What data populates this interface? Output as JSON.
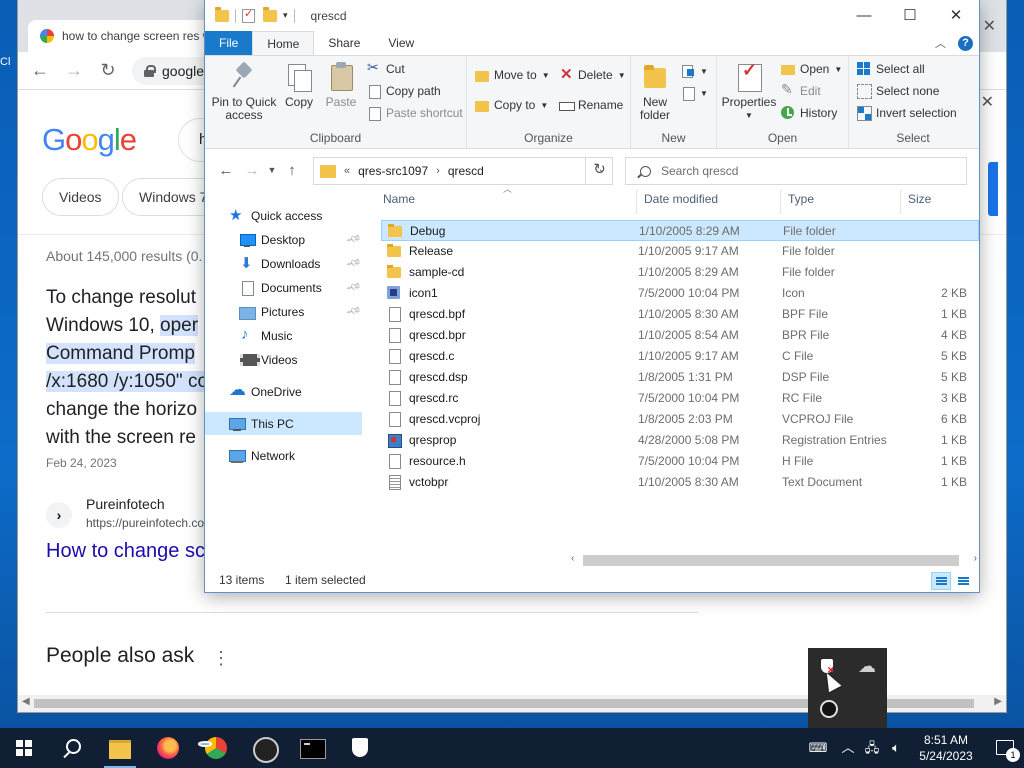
{
  "desktop": {
    "edge_text": "Cl"
  },
  "chrome": {
    "tab_title": "how to change screen res w",
    "url": "google.",
    "search_query_partial": "h",
    "chips": [
      "Videos",
      "Windows 7"
    ],
    "result_stats": "About 145,000 results (0.",
    "snippet_lines": [
      {
        "pre": "To change resolut",
        "hl": ""
      },
      {
        "pre": "Windows 10, ",
        "hl": "oper"
      },
      {
        "pre": "",
        "hl": "Command Promp"
      },
      {
        "pre": "",
        "hl": "/x:1680 /y:1050\" co"
      },
      {
        "pre": "change the horizo",
        "hl": ""
      },
      {
        "pre": "with the screen re",
        "hl": ""
      }
    ],
    "snippet_date": "Feb 24, 2023",
    "source_name": "Pureinfotech",
    "source_url": "https://pureinfotech.co",
    "result_title": "How to change sc",
    "people_also_ask": "People also ask"
  },
  "explorer": {
    "window_title": "qrescd",
    "ribbon_tabs": [
      "File",
      "Home",
      "Share",
      "View"
    ],
    "active_tab": "Home",
    "clipboard": {
      "pin_label": "Pin to Quick access",
      "copy": "Copy",
      "paste": "Paste",
      "cut": "Cut",
      "copy_path": "Copy path",
      "paste_shortcut": "Paste shortcut",
      "group": "Clipboard"
    },
    "organize": {
      "move_to": "Move to",
      "copy_to": "Copy to",
      "delete": "Delete",
      "rename": "Rename",
      "group": "Organize"
    },
    "new": {
      "new_folder": "New folder",
      "group": "New"
    },
    "open": {
      "properties": "Properties",
      "open": "Open",
      "edit": "Edit",
      "history": "History",
      "group": "Open"
    },
    "select": {
      "select_all": "Select all",
      "select_none": "Select none",
      "invert": "Invert selection",
      "group": "Select"
    },
    "path": [
      "qres-src1097",
      "qrescd"
    ],
    "path_prefix": "«",
    "search_placeholder": "Search qrescd",
    "nav": {
      "quick_access": "Quick access",
      "desktop": "Desktop",
      "downloads": "Downloads",
      "documents": "Documents",
      "pictures": "Pictures",
      "music": "Music",
      "videos": "Videos",
      "onedrive": "OneDrive",
      "this_pc": "This PC",
      "network": "Network"
    },
    "columns": [
      "Name",
      "Date modified",
      "Type",
      "Size"
    ],
    "files": [
      {
        "name": "Debug",
        "date": "1/10/2005 8:29 AM",
        "type": "File folder",
        "size": "",
        "icon": "folder"
      },
      {
        "name": "Release",
        "date": "1/10/2005 9:17 AM",
        "type": "File folder",
        "size": "",
        "icon": "folder"
      },
      {
        "name": "sample-cd",
        "date": "1/10/2005 8:29 AM",
        "type": "File folder",
        "size": "",
        "icon": "folder"
      },
      {
        "name": "icon1",
        "date": "7/5/2000 10:04 PM",
        "type": "Icon",
        "size": "2 KB",
        "icon": "ico"
      },
      {
        "name": "qrescd.bpf",
        "date": "1/10/2005 8:30 AM",
        "type": "BPF File",
        "size": "1 KB",
        "icon": "doc"
      },
      {
        "name": "qrescd.bpr",
        "date": "1/10/2005 8:54 AM",
        "type": "BPR File",
        "size": "4 KB",
        "icon": "doc"
      },
      {
        "name": "qrescd.c",
        "date": "1/10/2005 9:17 AM",
        "type": "C File",
        "size": "5 KB",
        "icon": "doc"
      },
      {
        "name": "qrescd.dsp",
        "date": "1/8/2005 1:31 PM",
        "type": "DSP File",
        "size": "5 KB",
        "icon": "doc"
      },
      {
        "name": "qrescd.rc",
        "date": "7/5/2000 10:04 PM",
        "type": "RC File",
        "size": "3 KB",
        "icon": "doc"
      },
      {
        "name": "qrescd.vcproj",
        "date": "1/8/2005 2:03 PM",
        "type": "VCPROJ File",
        "size": "6 KB",
        "icon": "doc"
      },
      {
        "name": "qresprop",
        "date": "4/28/2000 5:08 PM",
        "type": "Registration Entries",
        "size": "1 KB",
        "icon": "reg"
      },
      {
        "name": "resource.h",
        "date": "7/5/2000 10:04 PM",
        "type": "H File",
        "size": "1 KB",
        "icon": "doc"
      },
      {
        "name": "vctobpr",
        "date": "1/10/2005 8:30 AM",
        "type": "Text Document",
        "size": "1 KB",
        "icon": "doctext"
      }
    ],
    "selected_file": "Debug",
    "status_items": "13 items",
    "status_selected": "1 item selected"
  },
  "taskbar": {
    "time": "8:51 AM",
    "date": "5/24/2023",
    "notification_count": "1"
  }
}
